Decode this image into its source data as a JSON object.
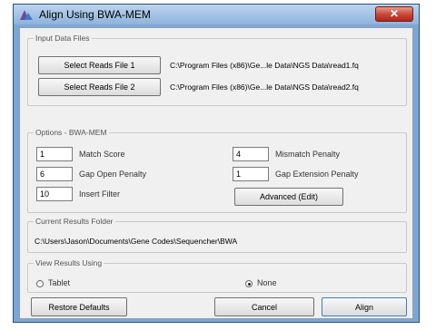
{
  "window": {
    "title": "Align Using BWA-MEM",
    "close_glyph": "✕"
  },
  "input_files": {
    "legend": "Input Data Files",
    "read1_button": "Select Reads File 1",
    "read1_path": "C:\\Program Files (x86)\\Ge...le Data\\NGS Data\\read1.fq",
    "read2_button": "Select Reads File 2",
    "read2_path": "C:\\Program Files (x86)\\Ge...le Data\\NGS Data\\read2.fq"
  },
  "options": {
    "legend": "Options - BWA-MEM",
    "match_score": {
      "value": "1",
      "label": "Match Score"
    },
    "gap_open_penalty": {
      "value": "6",
      "label": "Gap Open Penalty"
    },
    "insert_filter": {
      "value": "10",
      "label": "Insert Filter"
    },
    "mismatch_penalty": {
      "value": "4",
      "label": "Mismatch Penalty"
    },
    "gap_extension_penalty": {
      "value": "1",
      "label": "Gap Extension Penalty"
    },
    "advanced_button": "Advanced (Edit)"
  },
  "results_folder": {
    "legend": "Current Results Folder",
    "path": "C:\\Users\\Jason\\Documents\\Gene Codes\\Sequencher\\BWA"
  },
  "view_results": {
    "legend": "View Results Using",
    "options": [
      {
        "label": "Tablet",
        "selected": false
      },
      {
        "label": "None",
        "selected": true
      }
    ]
  },
  "footer": {
    "restore_button": "Restore Defaults",
    "cancel_button": "Cancel",
    "align_button": "Align"
  }
}
